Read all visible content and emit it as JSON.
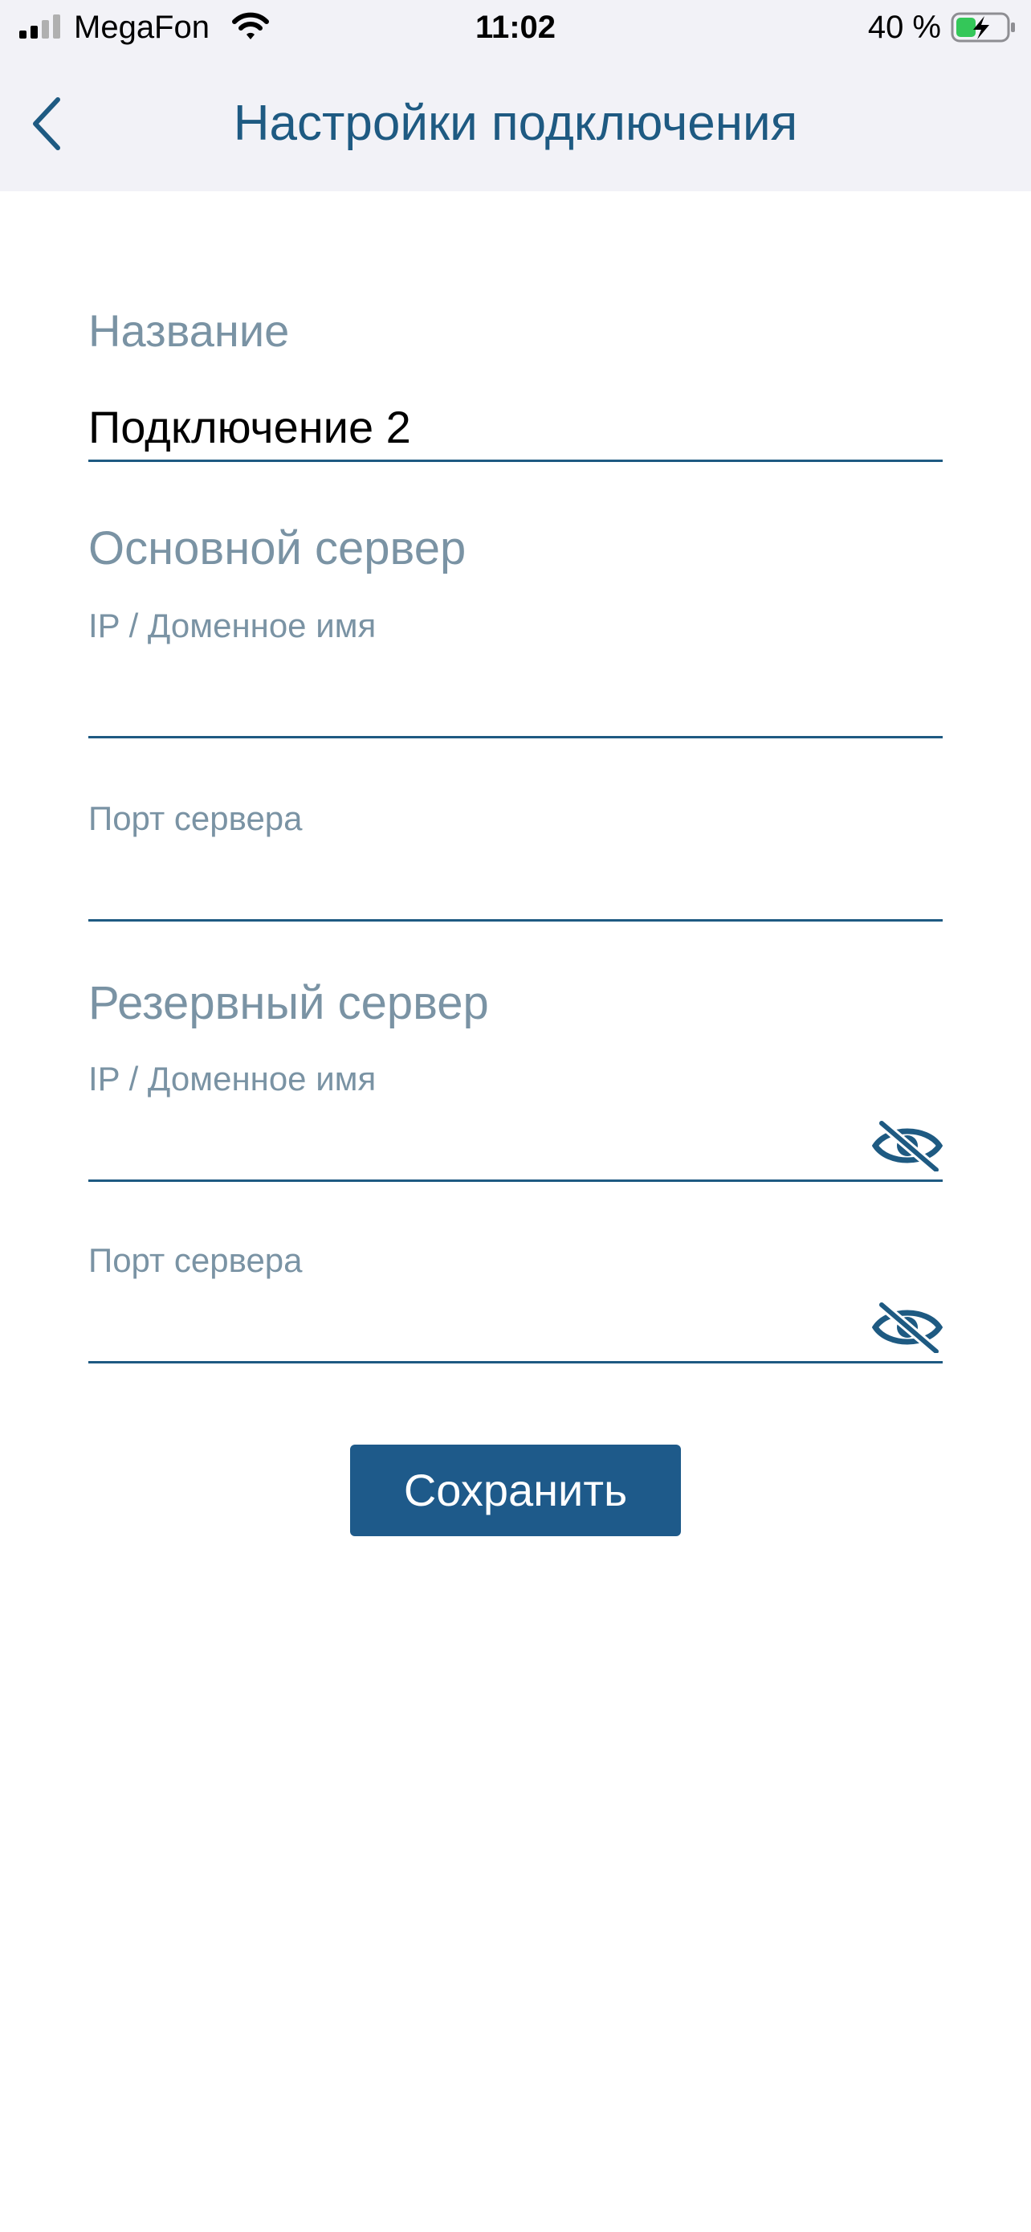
{
  "status_bar": {
    "carrier": "MegaFon",
    "time": "11:02",
    "battery_percent": "40 %",
    "battery_level": 0.4
  },
  "nav": {
    "title": "Настройки подключения",
    "back_icon": "chevron-left-icon"
  },
  "form": {
    "name_label": "Название",
    "name_value": "Подключение 2",
    "primary_section": "Основной сервер",
    "primary_host_label": "IP / Доменное имя",
    "primary_host_value": "",
    "primary_port_label": "Порт сервера",
    "primary_port_value": "",
    "backup_section": "Резервный сервер",
    "backup_host_label": "IP / Доменное имя",
    "backup_host_value": "",
    "backup_port_label": "Порт сервера",
    "backup_port_value": "",
    "visibility_icon": "eye-off-icon"
  },
  "actions": {
    "save_label": "Сохранить"
  },
  "colors": {
    "accent": "#1e5a82",
    "label": "#7a93a4",
    "button": "#1e5a8a",
    "header_bg": "#f2f2f7",
    "battery_charge": "#34c759"
  }
}
